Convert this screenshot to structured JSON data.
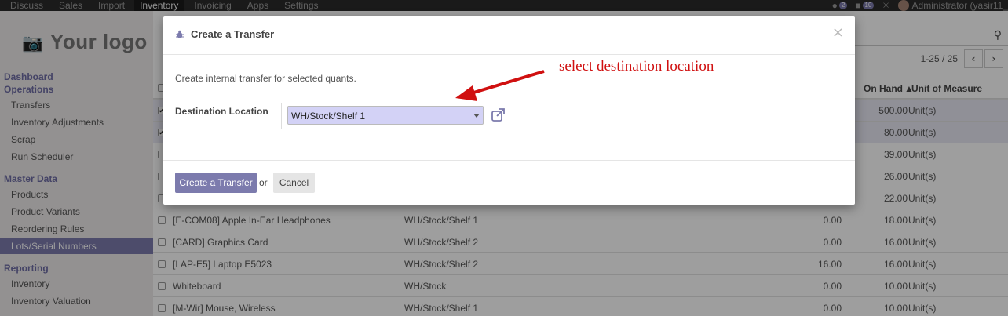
{
  "topbar": {
    "menu": [
      "Discuss",
      "Sales",
      "Import",
      "Inventory",
      "Invoicing",
      "Apps",
      "Settings"
    ],
    "active_menu": "Inventory",
    "chat_count": "2",
    "message_count": "10",
    "user": "Administrator (yasir11_"
  },
  "sidebar": {
    "logo": "Your logo",
    "sections": [
      {
        "title": "Dashboard",
        "items": []
      },
      {
        "title": "Operations",
        "items": [
          "Transfers",
          "Inventory Adjustments",
          "Scrap",
          "Run Scheduler"
        ]
      },
      {
        "title": "Master Data",
        "items": [
          "Products",
          "Product Variants",
          "Reordering Rules",
          "Lots/Serial Numbers"
        ]
      },
      {
        "title": "Reporting",
        "items": [
          "Inventory",
          "Inventory Valuation"
        ]
      }
    ],
    "active_item": "Lots/Serial Numbers"
  },
  "list": {
    "pager": "1-25 / 25",
    "columns": {
      "on_hand": "On Hand",
      "uom": "Unit of Measure"
    },
    "rows": [
      {
        "product": "",
        "location": "",
        "reserved": "",
        "on_hand": "500.00",
        "uom": "Unit(s)",
        "checked": true
      },
      {
        "product": "",
        "location": "",
        "reserved": "",
        "on_hand": "80.00",
        "uom": "Unit(s)",
        "checked": true
      },
      {
        "product": "",
        "location": "",
        "reserved": "",
        "on_hand": "39.00",
        "uom": "Unit(s)",
        "checked": false
      },
      {
        "product": "",
        "location": "",
        "reserved": "",
        "on_hand": "26.00",
        "uom": "Unit(s)",
        "checked": false
      },
      {
        "product": "",
        "location": "",
        "reserved": "",
        "on_hand": "22.00",
        "uom": "Unit(s)",
        "checked": false
      },
      {
        "product": "[E-COM08] Apple In-Ear Headphones",
        "location": "WH/Stock/Shelf 1",
        "reserved": "0.00",
        "on_hand": "18.00",
        "uom": "Unit(s)",
        "checked": false
      },
      {
        "product": "[CARD] Graphics Card",
        "location": "WH/Stock/Shelf 2",
        "reserved": "0.00",
        "on_hand": "16.00",
        "uom": "Unit(s)",
        "checked": false
      },
      {
        "product": "[LAP-E5] Laptop E5023",
        "location": "WH/Stock/Shelf 2",
        "reserved": "16.00",
        "on_hand": "16.00",
        "uom": "Unit(s)",
        "checked": false
      },
      {
        "product": "Whiteboard",
        "location": "WH/Stock",
        "reserved": "0.00",
        "on_hand": "10.00",
        "uom": "Unit(s)",
        "checked": false
      },
      {
        "product": "[M-Wir] Mouse, Wireless",
        "location": "WH/Stock/Shelf 1",
        "reserved": "0.00",
        "on_hand": "10.00",
        "uom": "Unit(s)",
        "checked": false
      }
    ]
  },
  "modal": {
    "title": "Create a Transfer",
    "description": "Create internal transfer for selected quants.",
    "field_label": "Destination Location",
    "field_value": "WH/Stock/Shelf 1",
    "primary_button": "Create a Transfer",
    "or_text": "or",
    "cancel_button": "Cancel",
    "close": "×"
  },
  "annotation": {
    "text": "select destination location",
    "color": "#d01010"
  },
  "colors": {
    "brand": "#7c7bad",
    "select_bg": "#d3d2f6",
    "navbar": "#2b2b2b"
  }
}
